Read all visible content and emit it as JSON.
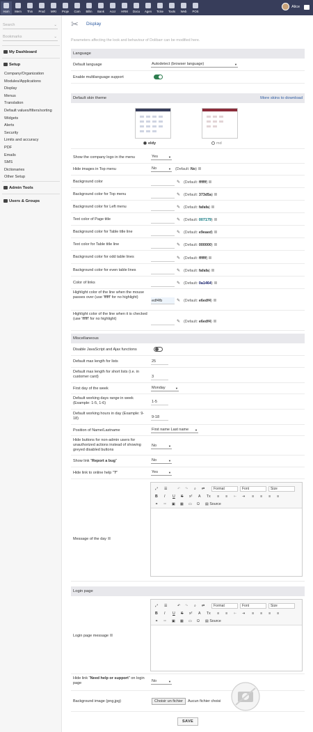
{
  "topmenu": [
    {
      "label": "Hom",
      "active": true
    },
    {
      "label": "Mem"
    },
    {
      "label": "Thin"
    },
    {
      "label": "Prod"
    },
    {
      "label": "MRI"
    },
    {
      "label": "Proje"
    },
    {
      "label": "Com"
    },
    {
      "label": "Billin"
    },
    {
      "label": "Bank"
    },
    {
      "label": "Accr"
    },
    {
      "label": "HRM"
    },
    {
      "label": "Docu"
    },
    {
      "label": "Agen"
    },
    {
      "label": "Ticke"
    },
    {
      "label": "Tools"
    },
    {
      "label": "Web"
    },
    {
      "label": "POS"
    }
  ],
  "user": {
    "name": "Alice"
  },
  "left": {
    "search_placeholder": "Search",
    "bookmarks_placeholder": "Bookmarks",
    "my_dashboard": "My Dashboard",
    "setup": "Setup",
    "setup_items": [
      "Company/Organization",
      "Modules/Applications",
      "Display",
      "Menus",
      "Translation",
      "Default values/filters/sorting",
      "Widgets",
      "Alerts",
      "Security",
      "Limits and accuracy",
      "PDF",
      "Emails",
      "SMS",
      "Dictionaries",
      "Other Setup"
    ],
    "admin_tools": "Admin Tools",
    "users_groups": "Users & Groups"
  },
  "page": {
    "title": "Display",
    "subtitle": "Parameters affecting the look and behaviour of Dolibarr can be modified here."
  },
  "language": {
    "header": "Language",
    "default_label": "Default language",
    "default_value": "Autodetect (browser language)",
    "multi_label": "Enable multilanguage support",
    "multi_on": true
  },
  "theme": {
    "header": "Default skin theme",
    "more_link": "More skins to download",
    "skins": [
      {
        "name": "eldy",
        "selected": true
      },
      {
        "name": "md",
        "selected": false
      }
    ]
  },
  "theme_rows": {
    "logo_label": "Show the company logo in the menu",
    "logo_value": "Yes",
    "hideimg_label": "Hide images in Top menu",
    "hideimg_value": "No",
    "hideimg_default": "No"
  },
  "colors": [
    {
      "label": "Background color",
      "value": "",
      "default": "ffffff",
      "defcolor": "#333333"
    },
    {
      "label": "Background color for Top menu",
      "value": "",
      "default": "373d5a",
      "defcolor": "#333333"
    },
    {
      "label": "Background color for Left menu",
      "value": "",
      "default": "fafafa",
      "defcolor": "#333333"
    },
    {
      "label": "Text color of Page title",
      "value": "",
      "default": "007179",
      "defcolor": "#007179"
    },
    {
      "label": "Background color for Table title line",
      "value": "",
      "default": "e9eaed",
      "defcolor": "#333333"
    },
    {
      "label": "Text color for Table title line",
      "value": "",
      "default": "000000",
      "defcolor": "#333333"
    },
    {
      "label": "Background color for odd table lines",
      "value": "",
      "default": "ffffff",
      "defcolor": "#333333"
    },
    {
      "label": "Background color for even table lines",
      "value": "",
      "default": "fafafa",
      "defcolor": "#333333"
    },
    {
      "label": "Color of links",
      "value": "",
      "default": "0a1464",
      "defcolor": "#0a1464"
    },
    {
      "label": "Highlight color of the line when the mouse passes over (use 'ffffff' for no highlight)",
      "value": "edf4fb",
      "default": "e6edf4",
      "defcolor": "#333333"
    },
    {
      "label": "Highlight color of the line when it is checked (use 'ffffff' for no highlight)",
      "value": "",
      "default": "e6edf4",
      "defcolor": "#333333"
    }
  ],
  "default_prefix": "(Default: ",
  "default_suffix": ")",
  "misc": {
    "header": "Miscellaneous",
    "js_label": "Disable JavaScript and Ajax functions",
    "js_on": false,
    "maxlen_label": "Default max length for lists",
    "maxlen_value": "25",
    "maxlen_short_label": "Default max length for short lists (i.e. in customer card)",
    "maxlen_short_value": "3",
    "firstday_label": "First day of the week",
    "firstday_value": "Monday",
    "workdays_label": "Default working days range in week (Example: 1-5, 1-6)",
    "workdays_value": "1-5",
    "workhours_label": "Default working hours in day (Example: 9-18)",
    "workhours_value": "9-18",
    "namepos_label": "Position of Name/Lastname",
    "namepos_value": "First name Last name",
    "hidebtn_label": "Hide buttons for non-admin users for unauthorized actions instead of showing greyed disabled buttons",
    "hidebtn_value": "No",
    "bug_label_pre": "Show link \"",
    "bug_label_bold": "Report a bug",
    "bug_label_post": "\"",
    "bug_value": "No",
    "help_label": "Hide link to online help \"",
    "help_value": "Yes",
    "motd_label": "Message of the day"
  },
  "editor": {
    "format": "Format",
    "font": "Font",
    "size": "Size",
    "source": "Source"
  },
  "login": {
    "header": "Login page",
    "message_label": "Login page message",
    "help_label_pre": "Hide link \"",
    "help_label_bold": "Need help or support",
    "help_label_post": "\" on login page",
    "help_value": "No",
    "bg_label": "Background image (png,jpg)",
    "file_button": "Choisir un fichier",
    "file_none": "Aucun fichier choisi"
  },
  "save": "SAVE"
}
